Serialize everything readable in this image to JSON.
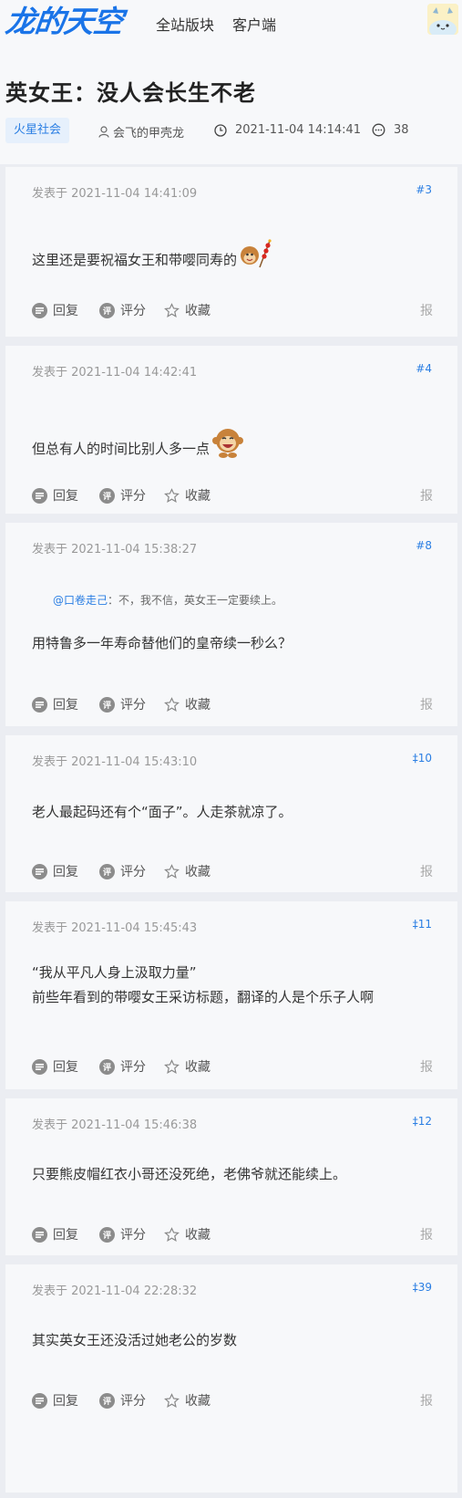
{
  "header": {
    "logo_text": "龙的天空",
    "nav": [
      "全站版块",
      "客户端"
    ]
  },
  "thread": {
    "title": "英女王：没人会长生不老",
    "tag": "火星社会",
    "author": "会飞的甲壳龙",
    "time": "2021-11-04 14:14:41",
    "comments": "38"
  },
  "actions": {
    "reply": "回复",
    "rate": "评分",
    "fav": "收藏",
    "report": "报",
    "rate_icon_text": "评"
  },
  "posts": [
    {
      "time": "发表于 2021-11-04 14:41:09",
      "floor": "#3",
      "lines": [
        "这里还是要祝福女王和带嘤同寿的"
      ],
      "emoji": "monkey-firecracker"
    },
    {
      "time": "发表于 2021-11-04 14:42:41",
      "floor": "#4",
      "lines": [
        "但总有人的时间比别人多一点"
      ],
      "emoji": "monkey-laugh"
    },
    {
      "time": "发表于 2021-11-04 15:38:27",
      "floor": "#8",
      "quote_at": "@口卷走己",
      "quote_text": "：不，我不信，英女王一定要续上。",
      "lines": [
        "用特鲁多一年寿命替他们的皇帝续一秒么？"
      ]
    },
    {
      "time": "发表于 2021-11-04 15:43:10",
      "floor": "‡10",
      "lines": [
        "老人最起码还有个“面子”。人走茶就凉了。"
      ]
    },
    {
      "time": "发表于 2021-11-04 15:45:43",
      "floor": "‡11",
      "lines": [
        "“我从平凡人身上汲取力量”",
        "前些年看到的带嘤女王采访标题，翻译的人是个乐子人啊"
      ]
    },
    {
      "time": "发表于 2021-11-04 15:46:38",
      "floor": "‡12",
      "lines": [
        "只要熊皮帽红衣小哥还没死绝，老佛爷就还能续上。"
      ]
    },
    {
      "time": "发表于 2021-11-04 22:28:32",
      "floor": "‡39",
      "lines": [
        "其实英女王还没活过她老公的岁数"
      ]
    }
  ]
}
